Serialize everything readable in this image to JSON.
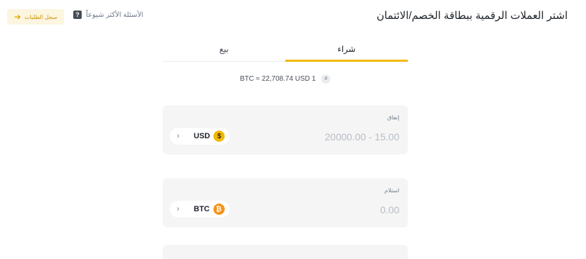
{
  "header": {
    "title": "اشتر العملات الرقمية ببطاقة الخصم/الائتمان",
    "faq_label": "الأسئلة الأكثر شيوعاً",
    "faq_icon": "?",
    "orders_label": "سجل الطلبات",
    "orders_arrow": "➔"
  },
  "tabs": [
    {
      "label": "شراء",
      "active": true
    },
    {
      "label": "بيع",
      "active": false
    }
  ],
  "rate": {
    "icon": "#",
    "text": "BTC ≈ 22,708.74 USD 1"
  },
  "spend": {
    "label": "إنفاق",
    "placeholder": "20000.00 - 15.00",
    "currency": "USD",
    "coin_symbol": "$",
    "chevron": "›"
  },
  "receive": {
    "label": "استلام",
    "placeholder": "0.00",
    "currency": "BTC",
    "coin_symbol": "₿",
    "chevron": "›"
  },
  "colors": {
    "accent": "#f0b90b",
    "card_bg": "#f5f5f5",
    "btc": "#f7931a"
  }
}
